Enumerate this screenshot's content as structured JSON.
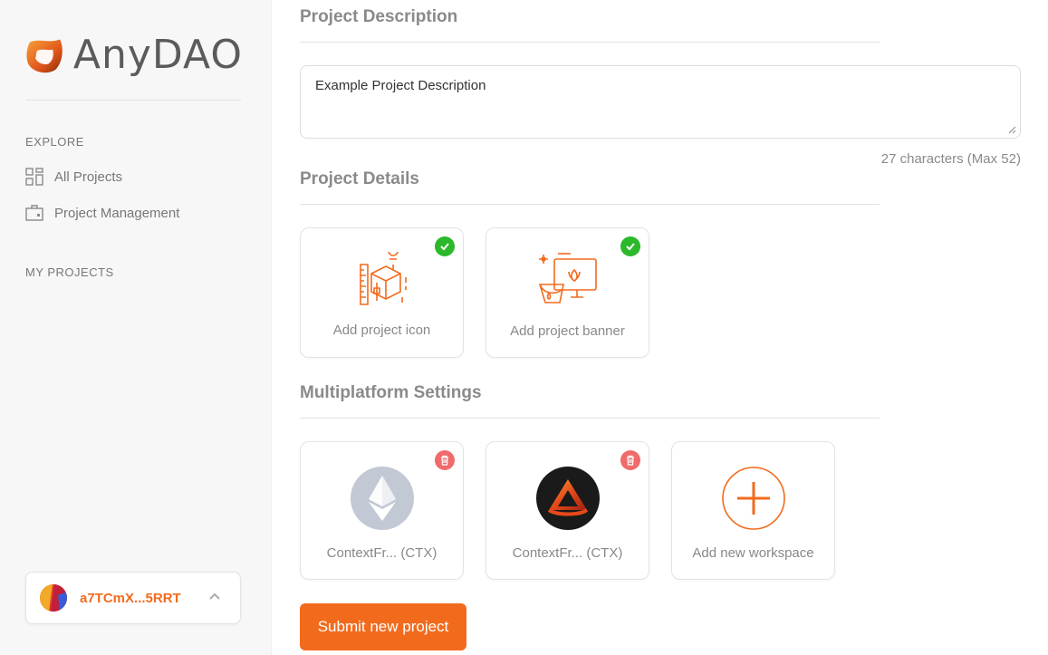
{
  "brand": {
    "name": "AnyDAO",
    "accent": "#f26b1d"
  },
  "sidebar": {
    "explore_heading": "EXPLORE",
    "items": [
      {
        "label": "All Projects",
        "icon": "grid-icon"
      },
      {
        "label": "Project Management",
        "icon": "briefcase-icon"
      }
    ],
    "my_projects_heading": "MY PROJECTS",
    "wallet": {
      "address": "a7TCmX...5RRT"
    }
  },
  "main": {
    "description_title": "Project Description",
    "description_value": "Example Project Description",
    "char_count": "27 characters (Max 52)",
    "details_title": "Project Details",
    "details_cards": [
      {
        "label": "Add project icon",
        "status": "complete"
      },
      {
        "label": "Add project banner",
        "status": "complete"
      }
    ],
    "multiplatform_title": "Multiplatform Settings",
    "workspaces": [
      {
        "label": "ContextFr... (CTX)",
        "platform": "ethereum-logo"
      },
      {
        "label": "ContextFr... (CTX)",
        "platform": "anydao-logo"
      }
    ],
    "add_workspace_label": "Add new workspace",
    "submit_label": "Submit new project"
  }
}
